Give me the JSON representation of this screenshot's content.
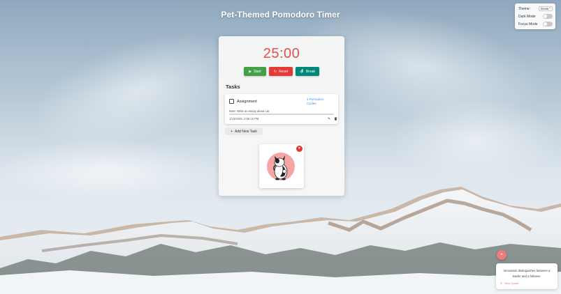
{
  "app": {
    "title": "Pet-Themed Pomodoro Timer"
  },
  "settings": {
    "theme_label": "Theme:",
    "theme_value": "Snow",
    "dark_mode_label": "Dark Mode",
    "focus_mode_label": "Focus Mode",
    "dark_mode_on": false,
    "focus_mode_on": false
  },
  "timer": {
    "display": "25:00"
  },
  "controls": {
    "start_label": "Start",
    "reset_label": "Reset",
    "break_label": "Break"
  },
  "tasks": {
    "heading": "Tasks",
    "items": [
      {
        "name": "Assignment",
        "pomodoro_line1": "1 Pomodoro",
        "pomodoro_line2": "Cycles",
        "note": "Note: Write an essay about cat",
        "progress": 0,
        "timestamp": "1/15/2025, 2:55:18 PM",
        "checked": false
      }
    ],
    "add_label": "Add New Task"
  },
  "quote": {
    "text": "Innovation distinguishes between a leader and a follower.",
    "new_label": "New Quote"
  },
  "colors": {
    "timer": "#e05050",
    "start": "#43a047",
    "reset": "#e53935",
    "break": "#00897b",
    "accent": "#3a8ee6"
  },
  "icons": {
    "start": "play-icon",
    "reset": "refresh-icon",
    "break": "running-icon",
    "add": "plus-icon",
    "edit": "pencil-icon",
    "delete": "trash-icon",
    "favorite": "heart-icon"
  }
}
